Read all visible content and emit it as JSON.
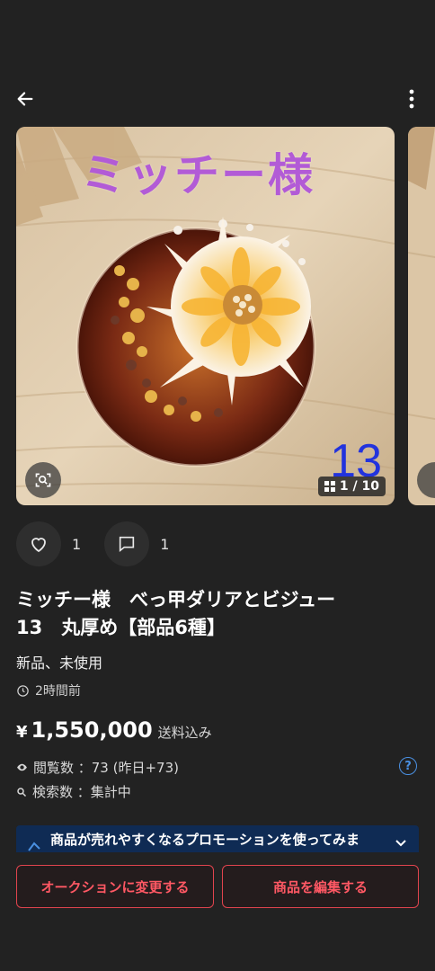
{
  "header": {
    "back_icon": "arrow-left-icon",
    "more_icon": "more-vertical-icon"
  },
  "gallery": {
    "overlay_name": "ミッチー様",
    "overlay_number": "13",
    "counter": "1 / 10",
    "scan_icon": "image-search-icon",
    "counter_icon": "grid-icon"
  },
  "actions": {
    "like_count": "1",
    "comment_count": "1"
  },
  "item": {
    "title_line1": "ミッチー様　べっ甲ダリアとビジュー",
    "title_line2": "13　丸厚め【部品6種】",
    "condition": "新品、未使用",
    "posted": "2時間前",
    "price_yen": "¥",
    "price_amount": "1,550,000",
    "shipping": "送料込み",
    "views": "閲覧数 ：73 (昨日+73)",
    "searches": "検索数 ：集計中",
    "help": "?"
  },
  "promo": {
    "text": "商品が売れやすくなるプロモーションを使ってみま"
  },
  "buttons": {
    "auction": "オークションに変更する",
    "edit": "商品を編集する"
  },
  "colors": {
    "background": "#222222",
    "accent_red": "#ff5864",
    "promo_bg": "#0f2b54",
    "link_blue": "#4a90e2"
  }
}
